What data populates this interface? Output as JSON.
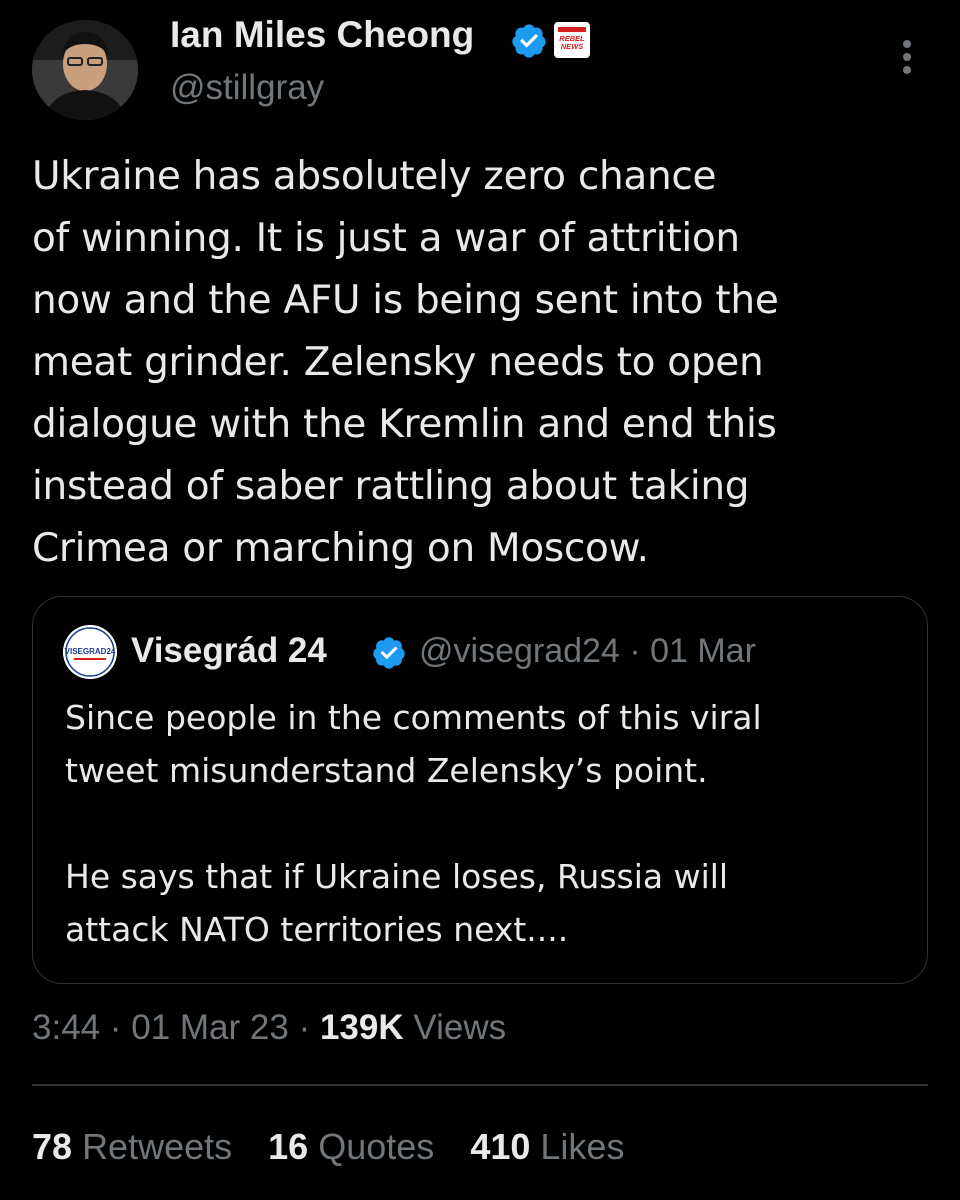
{
  "author": {
    "display_name": "Ian Miles Cheong",
    "handle": "@stillgray",
    "affiliate_badge_text": "REBEL NEWS"
  },
  "tweet": {
    "text": "Ukraine has absolutely zero chance\nof winning. It is just a war of attrition\nnow and the AFU is being sent into the\nmeat grinder. Zelensky needs to open\ndialogue with the Kremlin and end this\ninstead of saber rattling about taking\nCrimea or marching on Moscow."
  },
  "quoted_tweet": {
    "display_name": "Visegrád 24",
    "handle": "@visegrad24",
    "separator": "·",
    "date": "01 Mar",
    "avatar_text": "VISEGRAD24",
    "text": "Since people in the comments of this viral\ntweet misunderstand Zelensky’s point.\n\nHe says that if Ukraine loses, Russia will\nattack NATO territories next...."
  },
  "meta": {
    "time": "3:44",
    "separator": "·",
    "date": "01 Mar 23",
    "views_count": "139K",
    "views_label": "Views"
  },
  "stats": {
    "retweets_count": "78",
    "retweets_label": "Retweets",
    "quotes_count": "16",
    "quotes_label": "Quotes",
    "likes_count": "410",
    "likes_label": "Likes"
  },
  "colors": {
    "background": "#000000",
    "primary_text": "#e7e9ea",
    "secondary_text": "#71767b",
    "verified_blue": "#1d9bf0",
    "border": "#2f3336"
  },
  "icons": {
    "verified": "verified-badge-icon",
    "more": "more-options-icon"
  }
}
